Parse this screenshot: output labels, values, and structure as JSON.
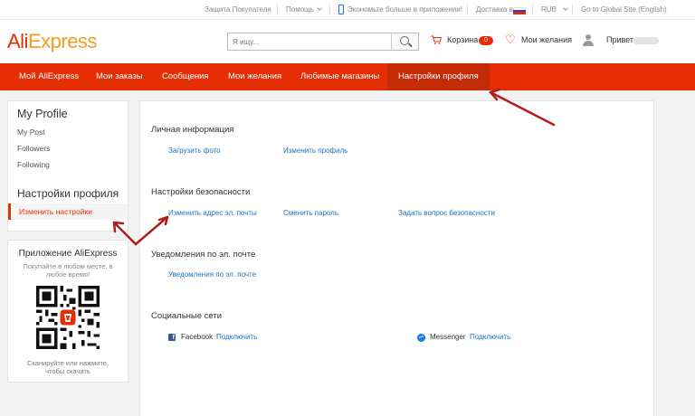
{
  "topbar": {
    "buyer_protection": "Защита Покупателя",
    "help": "Помощь",
    "app_promo": "Экономьте больше в приложении!",
    "delivery": "Доставка в",
    "currency": "RUB",
    "global_site": "Go to Global Site (English)"
  },
  "header": {
    "logo_ali": "Ali",
    "logo_express": "Express",
    "search_placeholder": "Я ищу...",
    "cart_label": "Корзина",
    "cart_count": "0",
    "wishlist_label": "Мои желания",
    "greeting": "Привет"
  },
  "nav": {
    "items": [
      "Мой AliExpress",
      "Мои заказы",
      "Сообщения",
      "Мои желания",
      "Любимые магазины",
      "Настройки профиля"
    ]
  },
  "sidebar": {
    "my_profile_title": "My Profile",
    "links": [
      "My Post",
      "Followers",
      "Following"
    ],
    "settings_title": "Настройки профиля",
    "active_item": "Изменить настройки"
  },
  "app_box": {
    "title": "Приложение AliExpress",
    "subtitle": "Покупайте в любом месте, в любое время!",
    "footer": "Сканируйте или нажмите, чтобы скачать"
  },
  "main": {
    "personal_title": "Личная информация",
    "upload_photo": "Загрузить фото",
    "edit_profile": "Изменить профиль",
    "security_title": "Настройки безопасности",
    "change_email": "Изменить адрес эл. почты",
    "change_password": "Сменить пароль",
    "security_question": "Задать вопрос безопасности",
    "email_notif_title": "Уведомления по эл. почте",
    "email_notif_link": "Уведомления по эл. почте",
    "social_title": "Социальные сети",
    "facebook": "Facebook",
    "facebook_connect": "Подключить",
    "messenger": "Messenger",
    "messenger_connect": "Подключить"
  },
  "colors": {
    "brand_red": "#e62e04",
    "brand_orange": "#f59b1d",
    "link_blue": "#1a73c8",
    "annotation_arrow": "#b31c1c"
  },
  "icons": [
    "phone-icon",
    "russia-flag-icon",
    "search-icon",
    "cart-icon",
    "heart-icon",
    "user-avatar-icon",
    "qr-code-icon",
    "facebook-icon",
    "messenger-icon"
  ]
}
